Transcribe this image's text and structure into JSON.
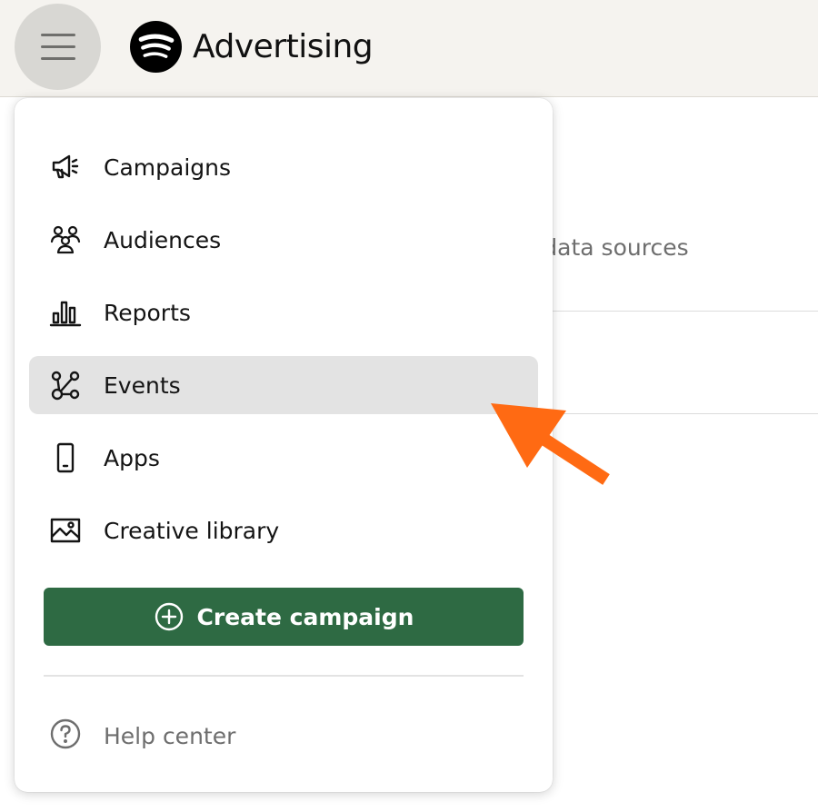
{
  "header": {
    "brand_name": "Advertising",
    "menu_icon": "hamburger-menu-icon",
    "logo_icon": "spotify-logo-icon"
  },
  "background": {
    "partial_text": "m data sources"
  },
  "menu": {
    "items": [
      {
        "label": "Campaigns",
        "icon": "megaphone-icon"
      },
      {
        "label": "Audiences",
        "icon": "people-group-icon"
      },
      {
        "label": "Reports",
        "icon": "bar-chart-icon"
      },
      {
        "label": "Events",
        "icon": "nodes-network-icon",
        "active": true
      },
      {
        "label": "Apps",
        "icon": "mobile-phone-icon"
      },
      {
        "label": "Creative library",
        "icon": "image-icon"
      }
    ],
    "create_button": {
      "label": "Create campaign",
      "icon": "plus-circle-icon"
    },
    "help": {
      "label": "Help center",
      "icon": "question-circle-icon"
    }
  },
  "colors": {
    "topbar_bg": "#f5f3ef",
    "active_item_bg": "#e3e3e3",
    "primary_button": "#2e6a43",
    "annotation_arrow": "#ff6a13"
  }
}
